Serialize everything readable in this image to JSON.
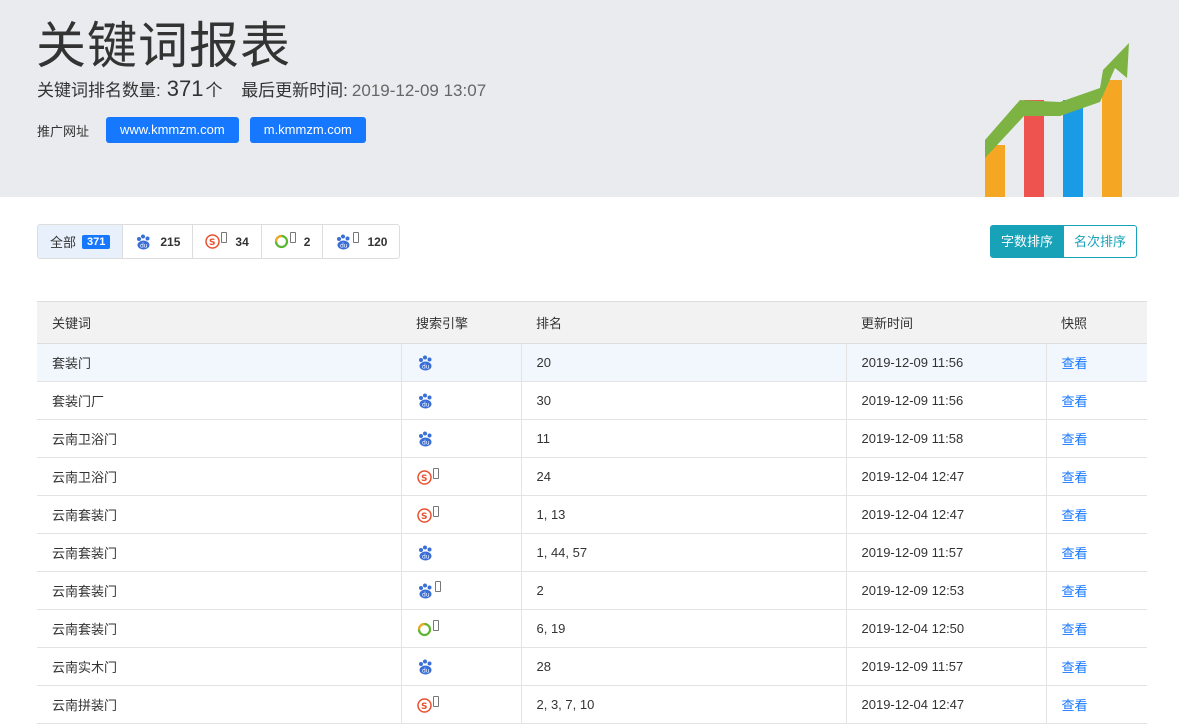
{
  "header": {
    "title": "关键词报表",
    "count_label": "关键词排名数量:",
    "count": "371",
    "count_unit": "个",
    "updated_label": "最后更新时间:",
    "updated_time": "2019-12-09 13:07",
    "promo_label": "推广网址",
    "urls": [
      "www.kmmzm.com",
      "m.kmmzm.com"
    ]
  },
  "filters": [
    {
      "label": "全部",
      "count": "371",
      "icon": "all"
    },
    {
      "label": "",
      "count": "215",
      "icon": "baidu-icon"
    },
    {
      "label": "",
      "count": "34",
      "icon": "sogou-mobile-icon"
    },
    {
      "label": "",
      "count": "2",
      "icon": "360-mobile-icon"
    },
    {
      "label": "",
      "count": "120",
      "icon": "baidu-mobile-icon"
    }
  ],
  "sort": {
    "by_chars": "字数排序",
    "by_rank": "名次排序"
  },
  "table": {
    "headers": [
      "关键词",
      "搜索引擎",
      "排名",
      "更新时间",
      "快照"
    ],
    "rows": [
      {
        "keyword": "套装门",
        "engine": "baidu",
        "rank": "20",
        "time": "2019-12-09 11:56",
        "link": "查看"
      },
      {
        "keyword": "套装门厂",
        "engine": "baidu",
        "rank": "30",
        "time": "2019-12-09 11:56",
        "link": "查看"
      },
      {
        "keyword": "云南卫浴门",
        "engine": "baidu",
        "rank": "11",
        "time": "2019-12-09 11:58",
        "link": "查看"
      },
      {
        "keyword": "云南卫浴门",
        "engine": "sogou-mobile",
        "rank": "24",
        "time": "2019-12-04 12:47",
        "link": "查看"
      },
      {
        "keyword": "云南套装门",
        "engine": "sogou-mobile",
        "rank": "1, 13",
        "time": "2019-12-04 12:47",
        "link": "查看"
      },
      {
        "keyword": "云南套装门",
        "engine": "baidu",
        "rank": "1, 44, 57",
        "time": "2019-12-09 11:57",
        "link": "查看"
      },
      {
        "keyword": "云南套装门",
        "engine": "baidu-mobile",
        "rank": "2",
        "time": "2019-12-09 12:53",
        "link": "查看"
      },
      {
        "keyword": "云南套装门",
        "engine": "360-mobile",
        "rank": "6, 19",
        "time": "2019-12-04 12:50",
        "link": "查看"
      },
      {
        "keyword": "云南实木门",
        "engine": "baidu",
        "rank": "28",
        "time": "2019-12-09 11:57",
        "link": "查看"
      },
      {
        "keyword": "云南拼装门",
        "engine": "sogou-mobile",
        "rank": "2, 3, 7, 10",
        "time": "2019-12-04 12:47",
        "link": "查看"
      }
    ]
  },
  "colors": {
    "primary": "#1677ff",
    "teal": "#17a2b8",
    "header_bg": "#e9ebee"
  }
}
